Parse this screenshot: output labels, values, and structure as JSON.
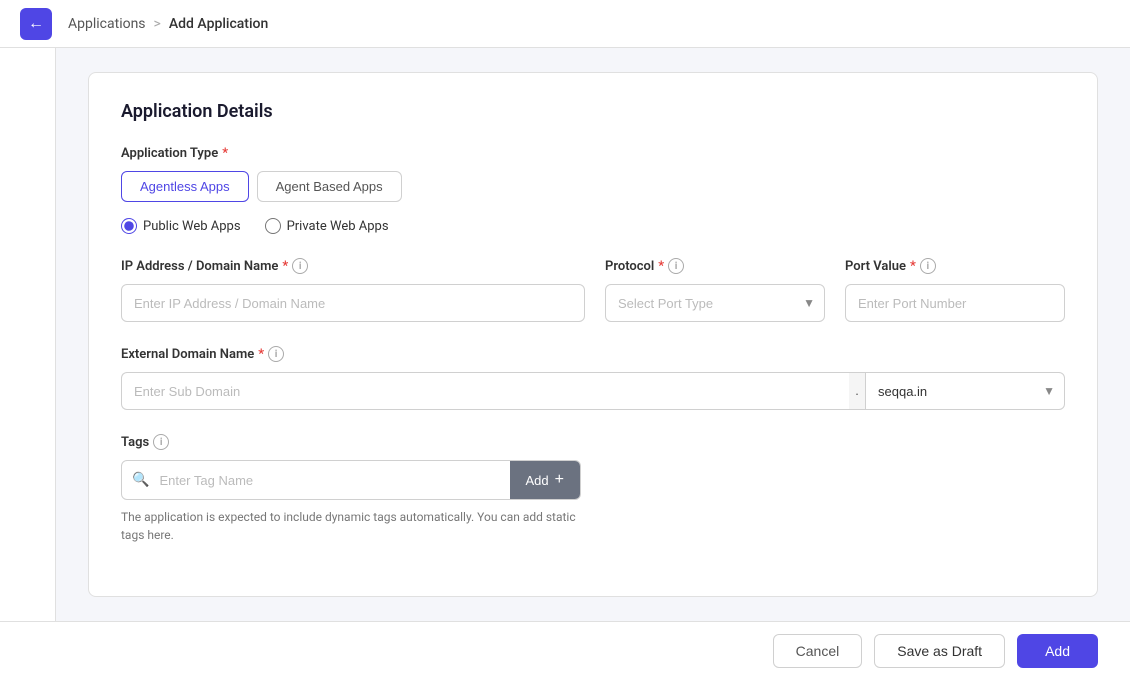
{
  "nav": {
    "back_label": "←",
    "breadcrumb_root": "Applications",
    "breadcrumb_separator": ">",
    "breadcrumb_current": "Add Application"
  },
  "card": {
    "title": "Application Details"
  },
  "form": {
    "app_type_label": "Application Type",
    "app_type_required": "*",
    "toggle_agentless": "Agentless Apps",
    "toggle_agent": "Agent Based Apps",
    "radio_public": "Public Web Apps",
    "radio_private": "Private Web Apps",
    "ip_label": "IP Address / Domain Name",
    "ip_required": "*",
    "ip_placeholder": "Enter IP Address / Domain Name",
    "protocol_label": "Protocol",
    "protocol_required": "*",
    "protocol_placeholder": "Select Port Type",
    "port_label": "Port Value",
    "port_required": "*",
    "port_placeholder": "Enter Port Number",
    "external_domain_label": "External Domain Name",
    "external_domain_required": "*",
    "subdomain_placeholder": "Enter Sub Domain",
    "domain_dot": ".",
    "domain_option": "seqqa.in",
    "tags_label": "Tags",
    "tags_search_placeholder": "Enter Tag Name",
    "tags_add_label": "Add",
    "tags_add_plus": "+",
    "tags_hint": "The application is expected to include dynamic tags automatically. You can add static tags here."
  },
  "footer": {
    "cancel_label": "Cancel",
    "draft_label": "Save as Draft",
    "add_label": "Add"
  },
  "icons": {
    "info": "i",
    "search": "🔍",
    "arrow_down": "▼"
  }
}
